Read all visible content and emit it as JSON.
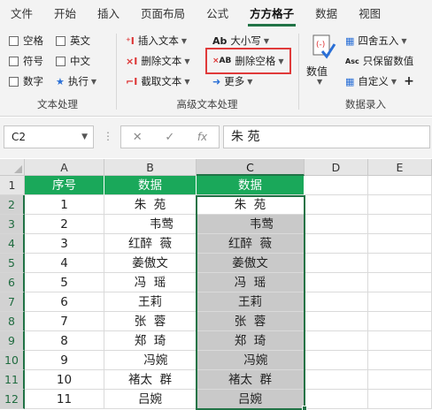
{
  "menu": [
    "文件",
    "开始",
    "插入",
    "页面布局",
    "公式",
    "方方格子",
    "数据",
    "视图"
  ],
  "active_menu_index": 5,
  "ribbon": {
    "text_group": {
      "checkboxes": [
        "空格",
        "英文",
        "符号",
        "中文",
        "数字"
      ],
      "execute_label": "执行",
      "label": "文本处理"
    },
    "advanced_group": {
      "insert_text": "插入文本",
      "delete_text": "删除文本",
      "extract_text": "截取文本",
      "case_label": "大小写",
      "delete_space": "删除空格",
      "more": "更多",
      "label": "高级文本处理",
      "case_icon": "Ab",
      "delete_space_icon": "AB"
    },
    "data_group": {
      "numeric_label": "数值",
      "round": "四舍五入",
      "keep_values": "只保留数值",
      "custom": "自定义",
      "label": "数据录入",
      "keep_values_icon": "Asc"
    },
    "plus": "+"
  },
  "formula_bar": {
    "name_box": "C2",
    "formula": "朱 苑",
    "fx": "fx"
  },
  "columns": [
    "A",
    "B",
    "C",
    "D",
    "E"
  ],
  "selected_column": "C",
  "rows": [
    {
      "num": "1",
      "a": "序号",
      "b": "数据",
      "c": "数据"
    },
    {
      "num": "2",
      "a": "1",
      "b": "朱  苑",
      "c": "朱  苑"
    },
    {
      "num": "3",
      "a": "2",
      "b": "      韦莺",
      "c": "      韦莺"
    },
    {
      "num": "4",
      "a": "3",
      "b": "红醉  薇",
      "c": "红醉  薇"
    },
    {
      "num": "5",
      "a": "4",
      "b": "姜傲文",
      "c": "姜傲文"
    },
    {
      "num": "6",
      "a": "5",
      "b": "冯  瑶",
      "c": "冯  瑶"
    },
    {
      "num": "7",
      "a": "6",
      "b": "王莉",
      "c": "王莉"
    },
    {
      "num": "8",
      "a": "7",
      "b": "张  蓉",
      "c": "张  蓉"
    },
    {
      "num": "9",
      "a": "8",
      "b": "郑  琦",
      "c": "郑  琦"
    },
    {
      "num": "10",
      "a": "9",
      "b": "   冯婉",
      "c": "   冯婉"
    },
    {
      "num": "11",
      "a": "10",
      "b": "褚太  群",
      "c": "褚太  群"
    },
    {
      "num": "12",
      "a": "11",
      "b": "吕婉",
      "c": "吕婉"
    }
  ],
  "colors": {
    "header_green": "#1aa85a",
    "excel_green": "#217346",
    "highlight_red": "#e03a3a"
  }
}
